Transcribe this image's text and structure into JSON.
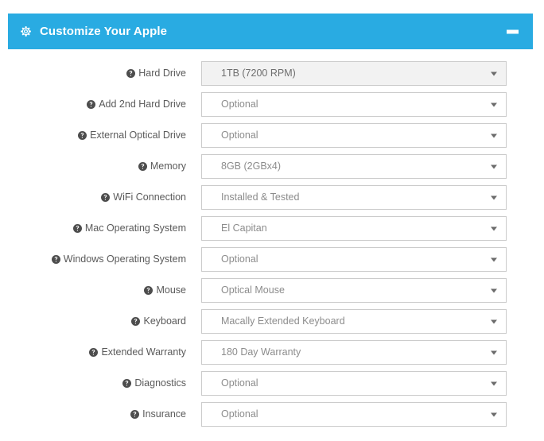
{
  "panel": {
    "title": "Customize Your Apple",
    "gear_icon": "gear-icon",
    "minimize_icon": "minimize-icon",
    "header_color": "#29abe2",
    "header_text_color": "#ffffff"
  },
  "help_icon": "question-mark-circle-icon",
  "caret_icon": "chevron-down-icon",
  "rows": [
    {
      "label": "Hard Drive",
      "value": "1TB (7200 RPM)",
      "filled": true
    },
    {
      "label": "Add 2nd Hard Drive",
      "value": "Optional",
      "filled": false
    },
    {
      "label": "External Optical Drive",
      "value": "Optional",
      "filled": false
    },
    {
      "label": "Memory",
      "value": "8GB (2GBx4)",
      "filled": false
    },
    {
      "label": "WiFi Connection",
      "value": "Installed & Tested",
      "filled": false
    },
    {
      "label": "Mac Operating System",
      "value": "El Capitan",
      "filled": false
    },
    {
      "label": "Windows Operating System",
      "value": "Optional",
      "filled": false
    },
    {
      "label": "Mouse",
      "value": "Optical Mouse",
      "filled": false
    },
    {
      "label": "Keyboard",
      "value": "Macally Extended Keyboard",
      "filled": false
    },
    {
      "label": "Extended Warranty",
      "value": "180 Day Warranty",
      "filled": false
    },
    {
      "label": "Diagnostics",
      "value": "Optional",
      "filled": false
    },
    {
      "label": "Insurance",
      "value": "Optional",
      "filled": false
    }
  ]
}
